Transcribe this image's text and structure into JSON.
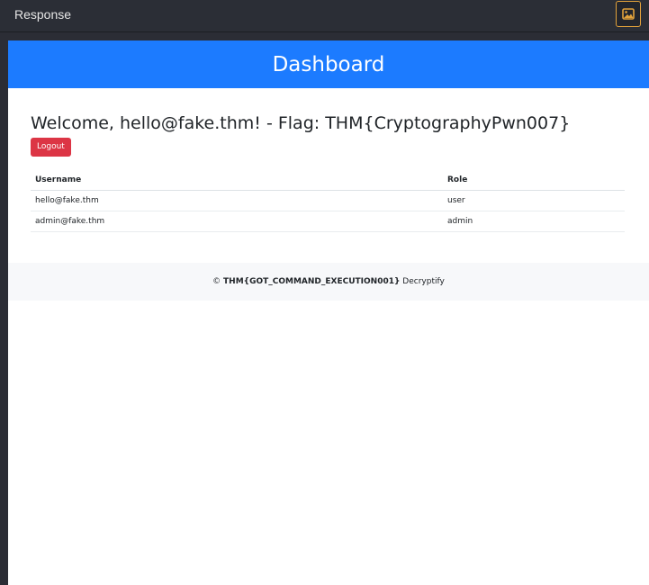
{
  "panel": {
    "title": "Response",
    "image_button_icon": "image-icon"
  },
  "page": {
    "header_title": "Dashboard",
    "welcome": "Welcome, hello@fake.thm! - Flag: THM{CryptographyPwn007}",
    "logout_label": "Logout",
    "table": {
      "headers": [
        "Username",
        "Role"
      ],
      "rows": [
        [
          "hello@fake.thm",
          "user"
        ],
        [
          "admin@fake.thm",
          "admin"
        ]
      ]
    },
    "footer": {
      "copyright_symbol": "©",
      "flag": "THM{GOT_COMMAND_EXECUTION001}",
      "brand": "Decryptify"
    }
  },
  "colors": {
    "hero_bg": "#1c7bff",
    "logout_bg": "#dc3545",
    "accent_border": "#e3a23b"
  }
}
